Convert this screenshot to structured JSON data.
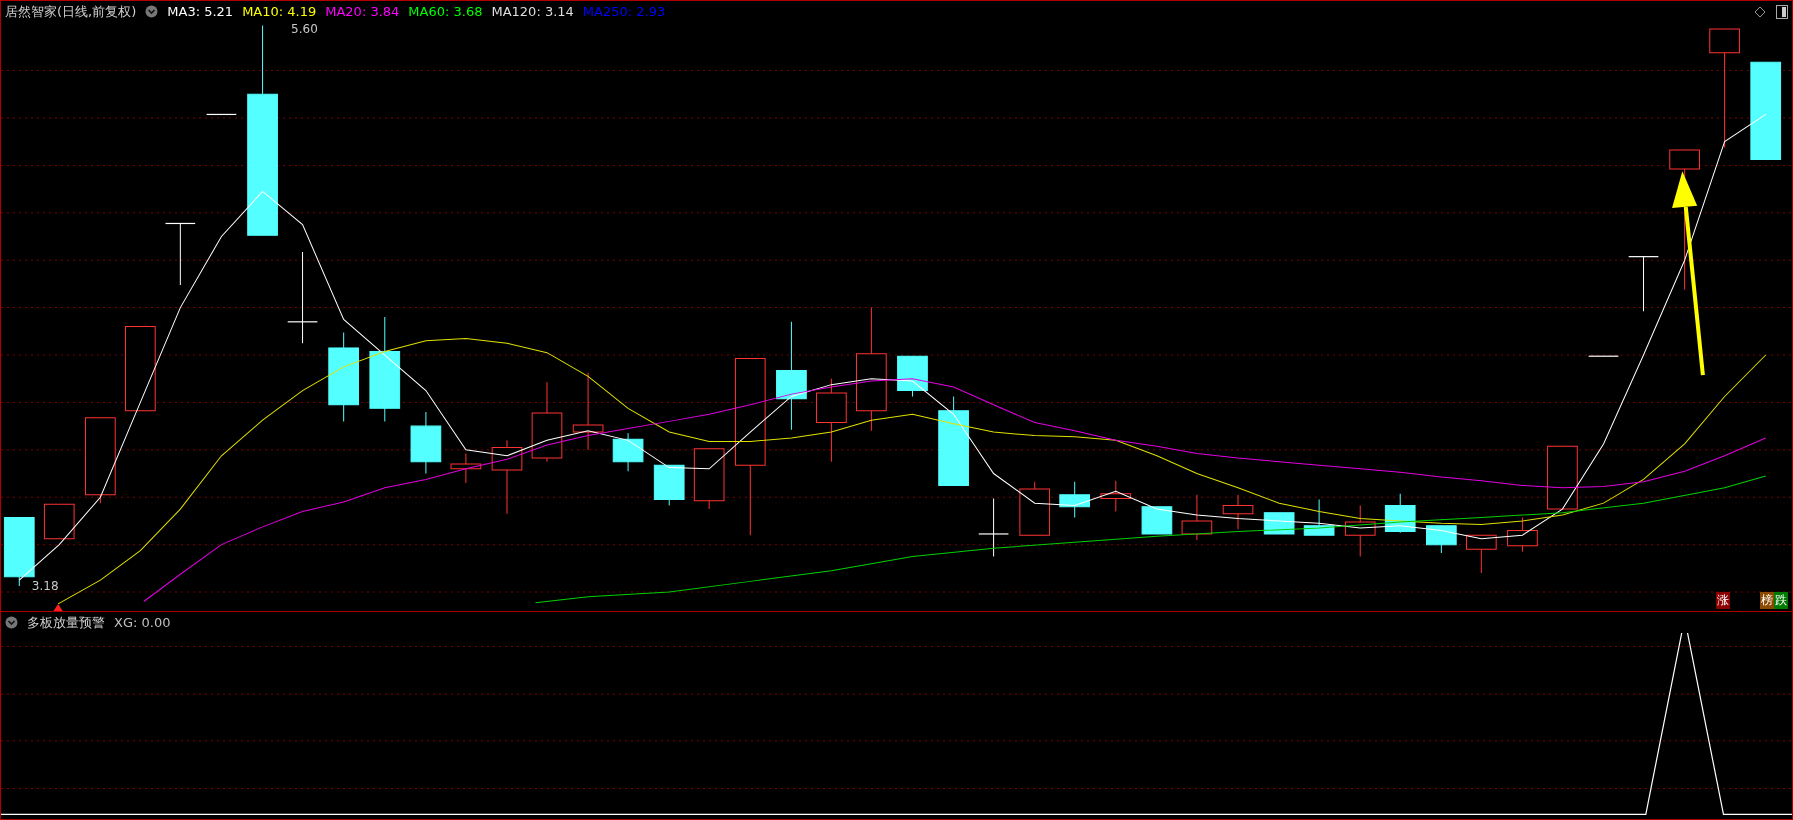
{
  "main_panel": {
    "title": "居然智家(日线,前复权)",
    "indicators": [
      {
        "label": "MA3: 5.21",
        "color": "#ffffff"
      },
      {
        "label": "MA10: 4.19",
        "color": "#ffff00"
      },
      {
        "label": "MA20: 3.84",
        "color": "#ff00ff"
      },
      {
        "label": "MA60: 3.68",
        "color": "#00ff00"
      },
      {
        "label": "MA120: 3.14",
        "color": "#dddddd"
      },
      {
        "label": "MA250: 2.93",
        "color": "#0000ff"
      }
    ],
    "high_label": "5.60",
    "low_label": "3.18",
    "badges": [
      {
        "text": "涨",
        "color": "#8b0000"
      },
      {
        "text": "榜",
        "color": "#8b4a00"
      },
      {
        "text": "跌",
        "color": "#007a00"
      }
    ]
  },
  "sub_panel": {
    "title": "多板放量预警",
    "indicators": [
      {
        "label": "XG: 0.00",
        "color": "#c0c0c0"
      }
    ]
  }
}
